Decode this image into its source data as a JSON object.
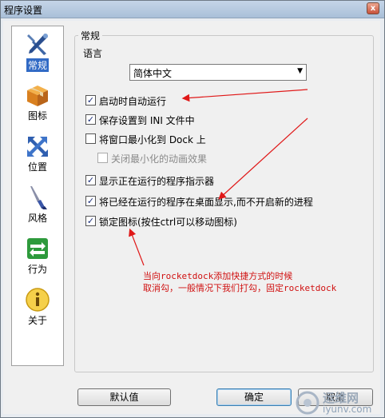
{
  "window": {
    "title": "程序设置",
    "close_glyph": "x"
  },
  "sidebar": {
    "items": [
      {
        "label": "常规",
        "icon": "tools-icon",
        "selected": true
      },
      {
        "label": "图标",
        "icon": "box-icon",
        "selected": false
      },
      {
        "label": "位置",
        "icon": "move-arrows-icon",
        "selected": false
      },
      {
        "label": "风格",
        "icon": "brush-icon",
        "selected": false
      },
      {
        "label": "行为",
        "icon": "swap-arrows-icon",
        "selected": false
      },
      {
        "label": "关于",
        "icon": "info-icon",
        "selected": false
      }
    ]
  },
  "general": {
    "group_title": "常规",
    "language_label": "语言",
    "language_value": "简体中文",
    "checkboxes": [
      {
        "label": "启动时自动运行",
        "checked": true,
        "disabled": false
      },
      {
        "label": "保存设置到 INI 文件中",
        "checked": true,
        "disabled": false
      },
      {
        "label": "将窗口最小化到 Dock 上",
        "checked": false,
        "disabled": false
      },
      {
        "label": "关闭最小化的动画效果",
        "checked": false,
        "disabled": true
      },
      {
        "label": "显示正在运行的程序指示器",
        "checked": true,
        "disabled": false
      },
      {
        "label": "将已经在运行的程序在桌面显示,而不开启新的进程",
        "checked": true,
        "disabled": false
      },
      {
        "label": "锁定图标(按住ctrl可以移动图标)",
        "checked": true,
        "disabled": false
      }
    ]
  },
  "annotation": {
    "line1": "当向rocketdock添加快捷方式的时候",
    "line2": "取消勾，一般情况下我们打勾，固定rocketdock",
    "color": "#d01010"
  },
  "buttons": {
    "defaults": "默认值",
    "ok": "确定",
    "cancel": "取消"
  },
  "watermark": {
    "top": "运维网",
    "bottom": "iyunv.com"
  }
}
